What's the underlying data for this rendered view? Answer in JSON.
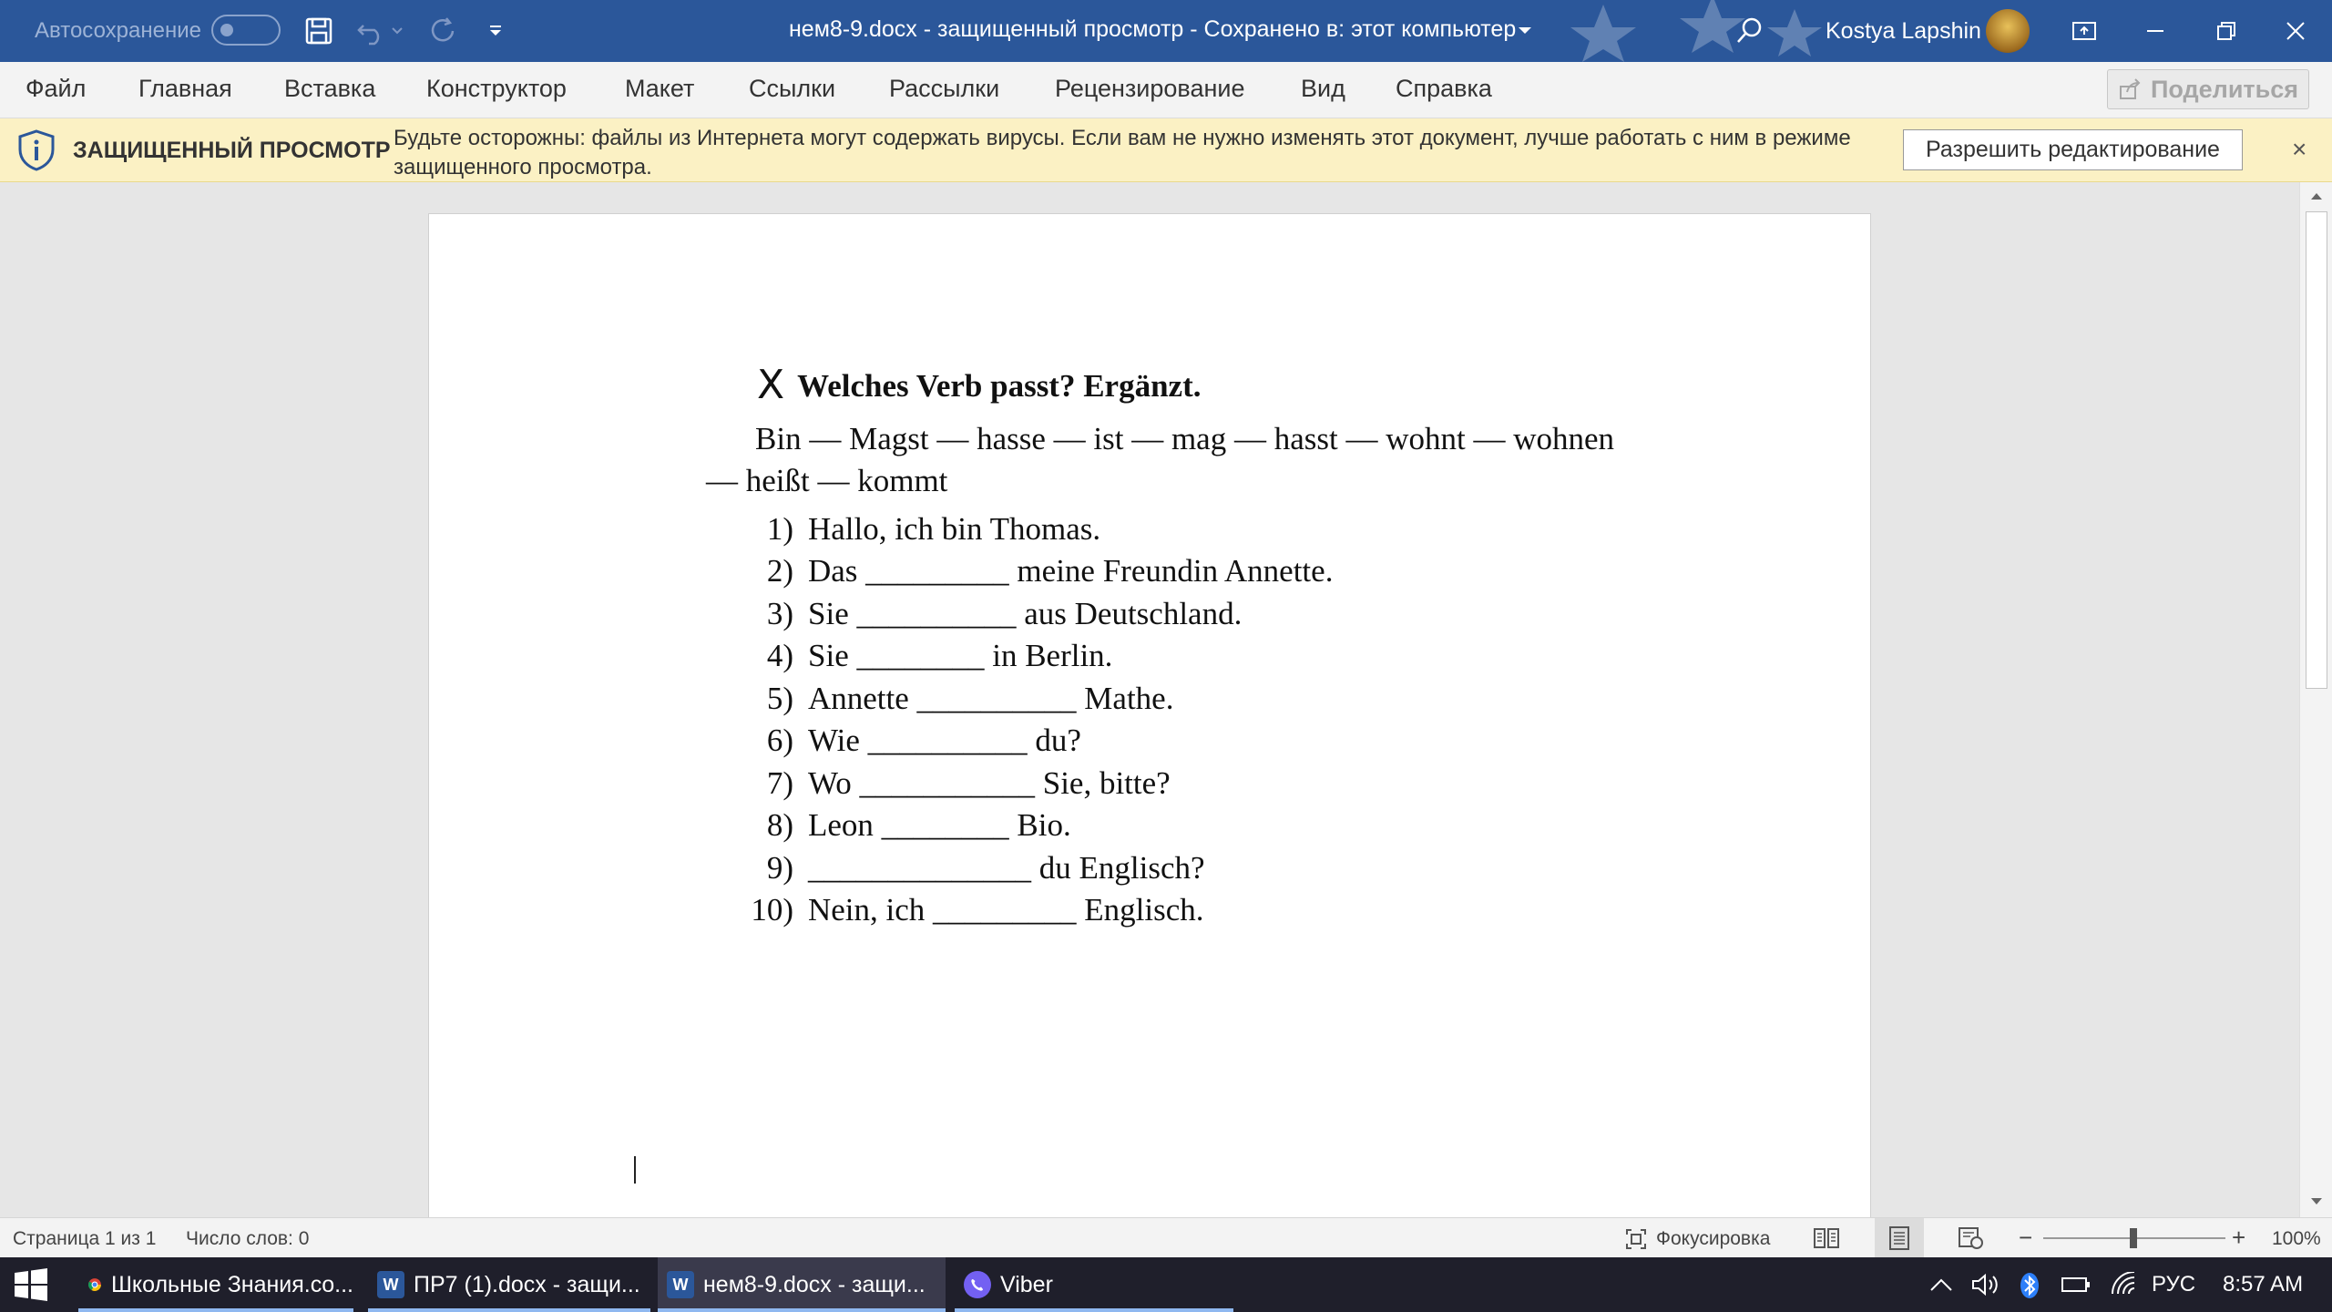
{
  "titlebar": {
    "autosave_label": "Автосохранение",
    "document_title": "нем8-9.docx  -  защищенный просмотр  -  Сохранено в: этот компьютер",
    "user_name": "Kostya Lapshin"
  },
  "menu": {
    "items": [
      "Файл",
      "Главная",
      "Вставка",
      "Конструктор",
      "Макет",
      "Ссылки",
      "Рассылки",
      "Рецензирование",
      "Вид",
      "Справка"
    ],
    "share_label": "Поделиться"
  },
  "protected_view": {
    "label": "ЗАЩИЩЕННЫЙ ПРОСМОТР",
    "message": "Будьте осторожны: файлы из Интернета могут содержать вирусы. Если вам не нужно изменять этот документ, лучше работать с ним в режиме защищенного просмотра.",
    "enable_button": "Разрешить редактирование",
    "close_symbol": "×"
  },
  "document": {
    "exercise_marker": "X",
    "heading": "Welches Verb passt? Ergänzt.",
    "word_bank": "Bin — Magst — hasse — ist — mag — hasst — wohnt — wohnen — heißt — kommt",
    "items": [
      {
        "num": "1)",
        "text": "Hallo, ich bin Thomas."
      },
      {
        "num": "2)",
        "text": "Das _________ meine Freundin Annette."
      },
      {
        "num": "3)",
        "text": "Sie __________ aus Deutschland."
      },
      {
        "num": "4)",
        "text": "Sie ________ in Berlin."
      },
      {
        "num": "5)",
        "text": "Annette __________ Mathe."
      },
      {
        "num": "6)",
        "text": "Wie __________ du?"
      },
      {
        "num": "7)",
        "text": "Wo ___________ Sie, bitte?"
      },
      {
        "num": "8)",
        "text": "Leon ________ Bio."
      },
      {
        "num": "9)",
        "text": "______________ du Englisch?"
      },
      {
        "num": "10)",
        "text": "Nein, ich _________ Englisch."
      }
    ]
  },
  "statusbar": {
    "page": "Страница 1 из 1",
    "word_count": "Число слов: 0",
    "focus": "Фокусировка",
    "zoom": "100%",
    "zoom_level": 1.0
  },
  "taskbar": {
    "apps": [
      {
        "label": "Школьные Знания.co...",
        "icon": "chrome-icon"
      },
      {
        "label": "ПР7 (1).docx  -  защи...",
        "icon": "word-icon"
      },
      {
        "label": "нем8-9.docx  -  защи...",
        "icon": "word-icon"
      },
      {
        "label": "Viber",
        "icon": "viber-icon"
      }
    ],
    "language": "РУС",
    "time": "8:57 AM"
  },
  "colors": {
    "titlebar": "#2b579a",
    "protected_bar": "#fbf1c4",
    "taskbar": "#1f1f2b"
  }
}
